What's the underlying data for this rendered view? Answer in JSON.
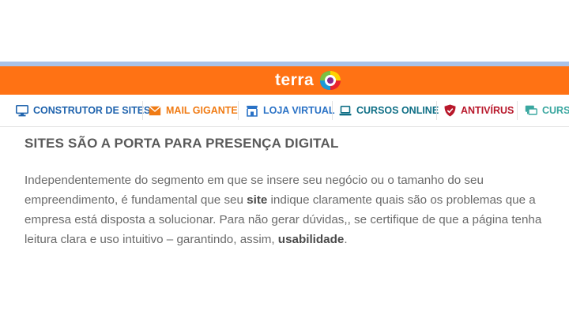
{
  "header": {
    "brand": "terra",
    "colors": {
      "bar": "#ff7214",
      "strip": "#a9c2e8"
    }
  },
  "nav": {
    "items": [
      {
        "label": "CONSTRUTOR DE SITES",
        "icon": "monitor-icon",
        "color": "#1f63ad"
      },
      {
        "label": "MAIL GIGANTE",
        "icon": "mail-icon",
        "color": "#f07b14"
      },
      {
        "label": "LOJA VIRTUAL",
        "icon": "store-icon",
        "color": "#2a72c6"
      },
      {
        "label": "CURSOS ONLINE",
        "icon": "laptop-icon",
        "color": "#0f6f86"
      },
      {
        "label": "ANTIVÍRUS",
        "icon": "shield-icon",
        "color": "#b8182b"
      },
      {
        "label": "CURSO",
        "icon": "chat-icon",
        "color": "#3aa7a0"
      }
    ]
  },
  "article": {
    "heading": "SITES SÃO A PORTA PARA PRESENÇA DIGITAL",
    "p1": "Independentemente do segmento em que se insere seu negócio ou o tamanho do seu empreendimento, é fundamental que seu ",
    "b1": "site",
    "p2": " indique claramente quais são os problemas que a empresa está disposta a solucionar. Para não gerar dúvidas,, se certifique de  que a página tenha leitura clara e uso intuitivo – garantindo, assim, ",
    "b2": "usabilidade",
    "p3": "."
  }
}
